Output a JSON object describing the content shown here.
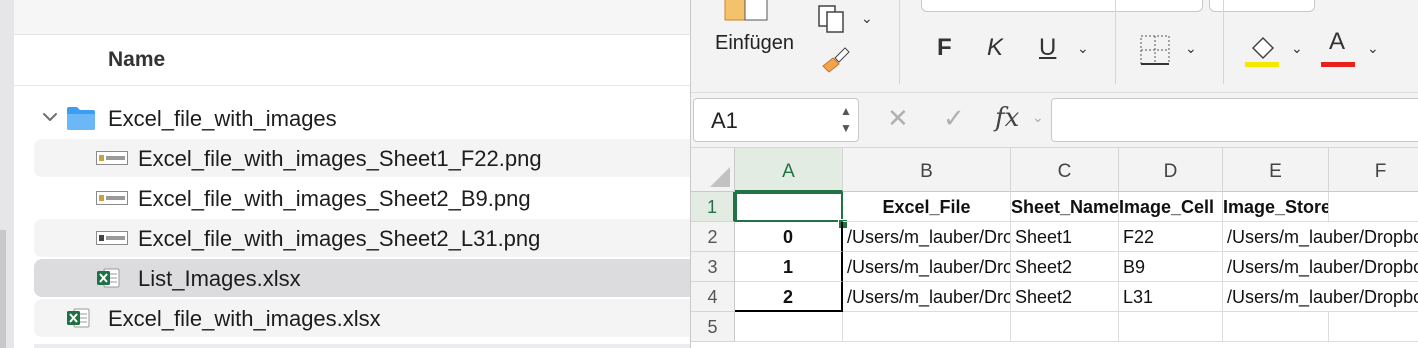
{
  "finder": {
    "column_header": "Name",
    "items": [
      {
        "label": "Excel_file_with_images",
        "icon": "folder-icon",
        "expanded": true
      },
      {
        "label": "Excel_file_with_images_Sheet1_F22.png",
        "icon": "png-image-icon"
      },
      {
        "label": "Excel_file_with_images_Sheet2_B9.png",
        "icon": "png-image-icon"
      },
      {
        "label": "Excel_file_with_images_Sheet2_L31.png",
        "icon": "png-image-icon"
      },
      {
        "label": "List_Images.xlsx",
        "icon": "excel-file-icon",
        "selected": true
      },
      {
        "label": "Excel_file_with_images.xlsx",
        "icon": "excel-file-icon"
      }
    ]
  },
  "excel": {
    "ribbon": {
      "paste_label": "Einfügen",
      "bold_label": "F",
      "italic_label": "K",
      "underline_label": "U",
      "font_color_label": "A",
      "highlight_color": "#f5e800",
      "font_color": "#e8211c"
    },
    "name_box": "A1",
    "formula_icon": "fx",
    "columns": [
      "A",
      "B",
      "C",
      "D",
      "E",
      "F"
    ],
    "rows": [
      "1",
      "2",
      "3",
      "4",
      "5"
    ],
    "headers": {
      "b": "Excel_File",
      "c": "Sheet_Name",
      "d": "Image_Cell",
      "e": "Image_Stored_Path"
    },
    "data": [
      {
        "a": "0",
        "b": "/Users/m_lauber/Dropbox",
        "c": "Sheet1",
        "d": "F22",
        "e": "/Users/m_lauber/Dropbox"
      },
      {
        "a": "1",
        "b": "/Users/m_lauber/Dropbox",
        "c": "Sheet2",
        "d": "B9",
        "e": "/Users/m_lauber/Dropbox"
      },
      {
        "a": "2",
        "b": "/Users/m_lauber/Dropbox",
        "c": "Sheet2",
        "d": "L31",
        "e": "/Users/m_lauber/Dropbox"
      }
    ],
    "accent": "#217346"
  }
}
